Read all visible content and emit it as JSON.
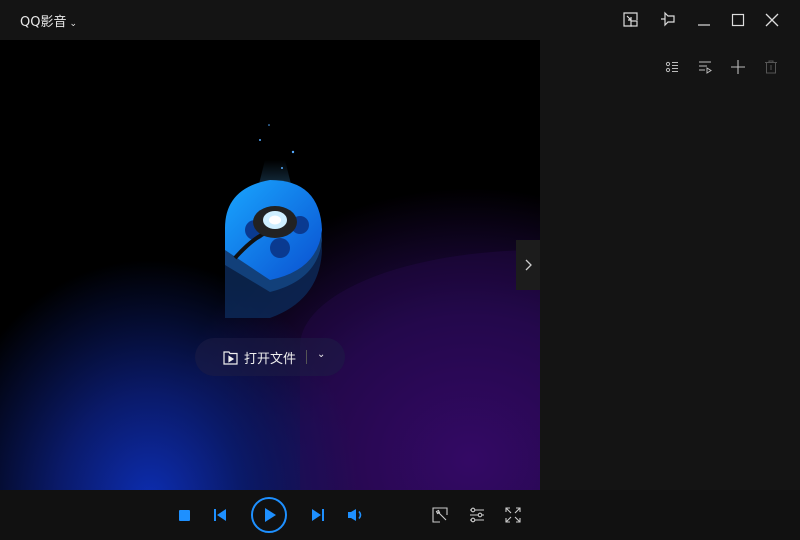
{
  "app": {
    "title": "QQ影音"
  },
  "player": {
    "open_file_label": "打开文件"
  },
  "colors": {
    "accent": "#1e90ff",
    "background": "#141414"
  }
}
